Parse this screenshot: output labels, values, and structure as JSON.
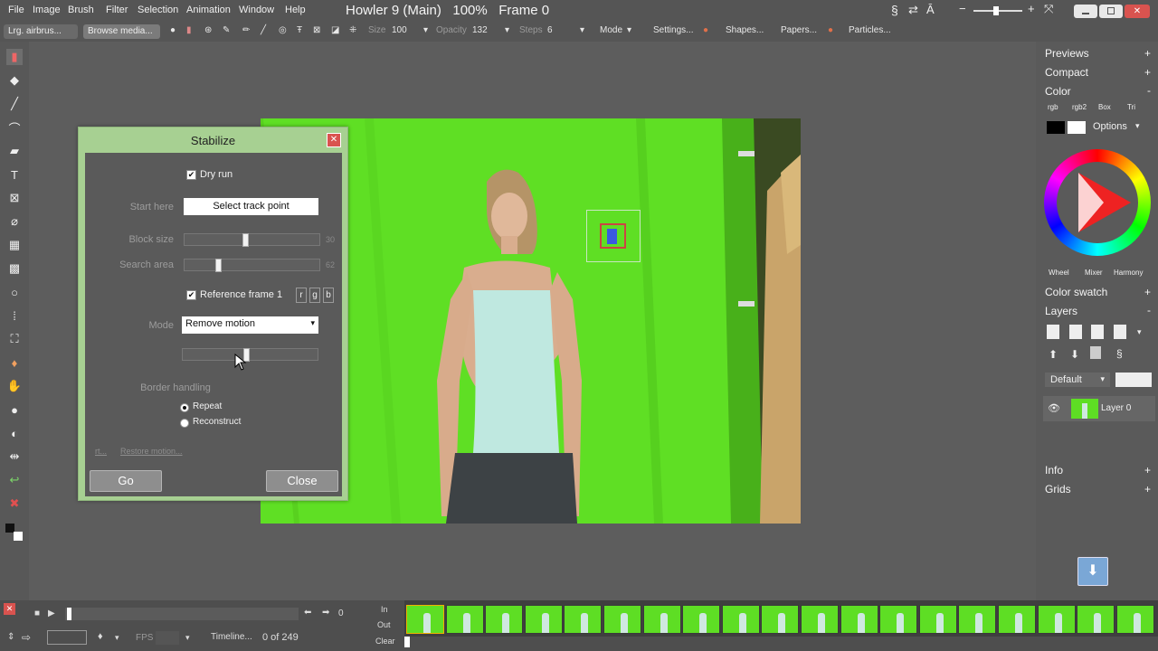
{
  "menu": [
    "File",
    "Image",
    "Brush",
    "Filter",
    "Selection",
    "Animation",
    "Window",
    "Help"
  ],
  "app_title": "Howler 9 (Main)",
  "zoom": "100%",
  "frame_label": "Frame 0",
  "toolbar": {
    "brush_preset": "Lrg. airbrus...",
    "browse_media": "Browse media...",
    "size_label": "Size",
    "size_value": "100",
    "opacity_label": "Opacity",
    "opacity_value": "132",
    "steps_label": "Steps",
    "steps_value": "6",
    "mode": "Mode",
    "settings": "Settings...",
    "shapes": "Shapes...",
    "papers": "Papers...",
    "particles": "Particles..."
  },
  "right_panel": {
    "previews": "Previews",
    "compact": "Compact",
    "color": "Color",
    "color_tabs": [
      "rgb",
      "rgb2",
      "Box",
      "Tri"
    ],
    "options": "Options",
    "wheel_tabs": [
      "Wheel",
      "Mixer",
      "Harmony"
    ],
    "color_swatch": "Color swatch",
    "layers": "Layers",
    "blend_mode": "Default",
    "layer_name": "Layer 0",
    "info": "Info",
    "grids": "Grids",
    "plus": "+",
    "minus": "-"
  },
  "dialog": {
    "title": "Stabilize",
    "dry_run": "Dry run",
    "start_here": "Start here",
    "select_track_point": "Select track point",
    "block_size": "Block size",
    "block_size_value": "30",
    "search_area": "Search area",
    "search_area_value": "62",
    "reference_frame": "Reference frame 1",
    "channels": [
      "r",
      "g",
      "b"
    ],
    "mode_label": "Mode",
    "mode_value": "Remove motion",
    "border_handling": "Border handling",
    "repeat": "Repeat",
    "reconstruct": "Reconstruct",
    "link_short": "rt...",
    "restore_motion": "Restore motion...",
    "go": "Go",
    "close": "Close",
    "block_size_fraction": 0.45,
    "search_area_fraction": 0.24,
    "extra_slider_fraction": 0.47
  },
  "timeline": {
    "counter_value": "0",
    "fps_label": "FPS",
    "timeline_btn": "Timeline...",
    "frame_count": "0 of 249",
    "in_label": "In",
    "out_label": "Out",
    "clear_label": "Clear",
    "frames": 19
  }
}
